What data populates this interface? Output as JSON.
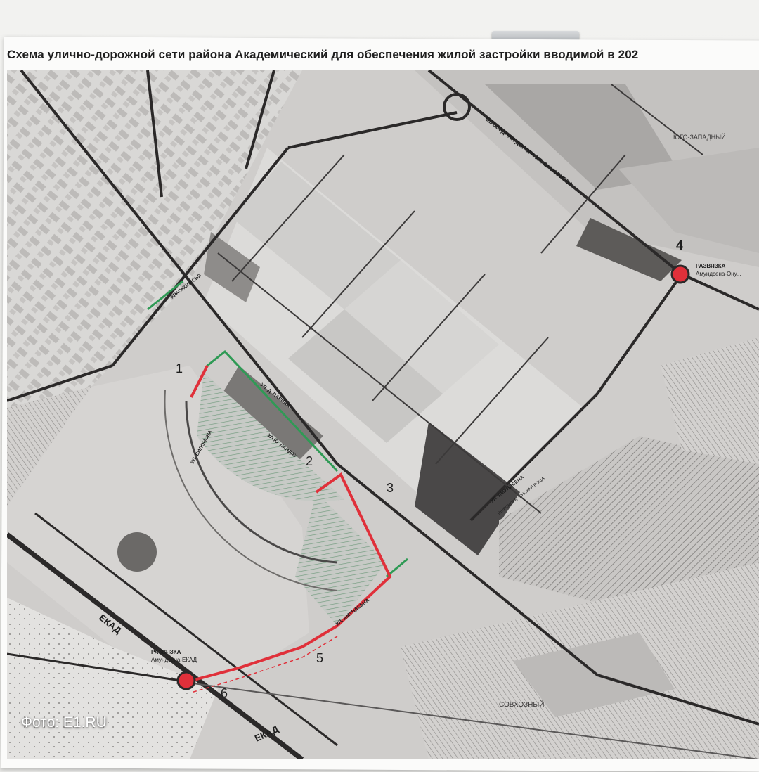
{
  "title": "Схема улично-дорожной сети района Академический для обеспечения жилой застройки вводимой в 202",
  "photo_credit": "Фото: E1.RU",
  "districts": {
    "yugo_zapadny": "ЮГО-ЗАПАДНЫЙ",
    "sovkhozny": "СОВХОЗНЫЙ"
  },
  "streets": {
    "ekad_1": "ЕКАД",
    "ekad_2": "ЕКАД",
    "obezdnaya": "ОБЪЕЗДНАЯ ДОРОГА УЛ. ОНУФРИЕВА",
    "krasnolesya": "КРАСНОЛЕСЬЯ",
    "vilonova": "УЛ. ВИЛОНОВА",
    "parina": "УЛ. Д. ПАРИНА",
    "lamdina": "УЛ.Ю. ЛАНДАУ",
    "amundsena": "УЛ. АМУНДСЕНА",
    "amundsena_2": "УЛ. АМУНДСЕНА",
    "shirokorechenskaya": "ШИРОКОРЕЧЕНСКАЯ РОЩА"
  },
  "interchanges": [
    {
      "number": "4",
      "label": "РАЗВЯЗКА",
      "sublabel": "Амундсена-Ону..."
    },
    {
      "number": "",
      "label": "РАЗВЯЗКА",
      "sublabel": "Амундсена-ЕКАД"
    }
  ],
  "markers": [
    "1",
    "2",
    "3",
    "5",
    "6"
  ],
  "colors": {
    "road_red": "#e0303a",
    "road_green": "#2f9a55",
    "dark_block": "#5a5858",
    "mid_block": "#9c9a98",
    "map_bg": "#cfcdcb"
  }
}
